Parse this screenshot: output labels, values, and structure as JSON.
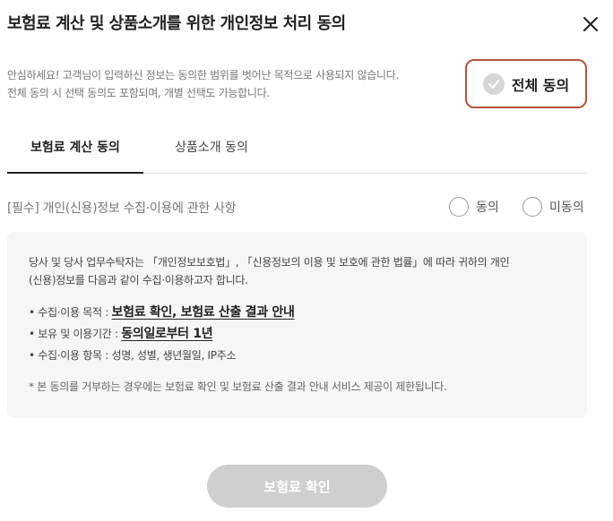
{
  "dialog": {
    "title": "보험료 계산 및 상품소개를 위한 개인정보 처리 동의",
    "intro_line1": "안심하세요! 고객님이 입력하신 정보는 동의한 범위를 벗어난 목적으로 사용되지 않습니다.",
    "intro_line2": "전체 동의 시 선택 동의도 포함되며, 개별 선택도 가능합니다.",
    "all_agree_label": "전체 동의",
    "accent_color": "#b5533c"
  },
  "tabs": [
    {
      "label": "보험료 계산 동의",
      "active": true
    },
    {
      "label": "상품소개 동의",
      "active": false
    }
  ],
  "section": {
    "required_label": "[필수] 개인(신용)정보 수집·이용에 관한 사항",
    "agree_label": "동의",
    "disagree_label": "미동의",
    "lead_line1": "당사 및 당사 업무수탁자는 「개인정보보호법」, 「신용정보의 이용 및 보호에 관한 법률」에 따라 귀하의 개인",
    "lead_line2": "(신용)정보를 다음과 같이 수집·이용하고자 합니다.",
    "items": [
      {
        "key": "• 수집·이용 목적 : ",
        "value": "보험료 확인, 보험료 산출 결과 안내"
      },
      {
        "key": "• 보유 및 이용기간 : ",
        "value": "동의일로부터 1년"
      },
      {
        "key": "• 수집·이용 항목 : ",
        "value": "성명, 성별, 생년월일, IP주소"
      }
    ],
    "note": "* 본 동의를 거부하는 경우에는 보험료 확인 및 보험료 산출 결과 안내 서비스 제공이 제한됩니다."
  },
  "footer": {
    "confirm_label": "보험료 확인"
  }
}
